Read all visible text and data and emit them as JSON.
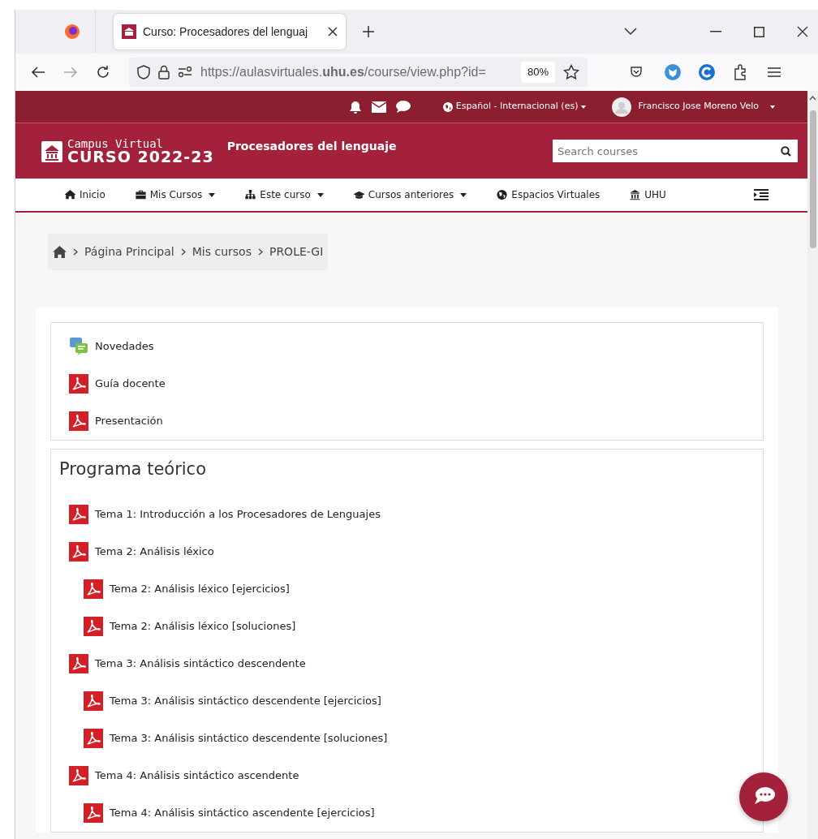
{
  "browser": {
    "tab_title": "Curso: Procesadores del lenguaj",
    "url": "https://aulasvirtuales.**uhu.es**/course/view.php?id=",
    "zoom": "80%",
    "forward_disabled": true
  },
  "topbar": {
    "language": "Español - Internacional (es)",
    "user": "Francisco Jose Moreno Velo"
  },
  "header": {
    "logo_line1": "Campus Virtual",
    "logo_line2": "CURSO 2022-23",
    "course_title": "Procesadores del lenguaje",
    "search_placeholder": "Search courses"
  },
  "nav": [
    {
      "label": "Inicio",
      "dropdown": false
    },
    {
      "label": "Mis Cursos",
      "dropdown": true
    },
    {
      "label": "Este curso",
      "dropdown": true
    },
    {
      "label": "Cursos anteriores",
      "dropdown": true
    },
    {
      "label": "Espacios Virtuales",
      "dropdown": false
    },
    {
      "label": "UHU",
      "dropdown": false
    }
  ],
  "breadcrumb": [
    "Página Principal",
    "Mis cursos",
    "PROLE-GI"
  ],
  "sections": [
    {
      "items": [
        {
          "kind": "forum",
          "label": "Novedades"
        },
        {
          "kind": "pdf",
          "label": "Guía docente"
        },
        {
          "kind": "pdf",
          "label": "Presentación"
        }
      ]
    },
    {
      "title": "Programa teórico",
      "items": [
        {
          "kind": "pdf",
          "label": "Tema 1: Introducción a los Procesadores de Lenguajes"
        },
        {
          "kind": "pdf",
          "label": "Tema 2: Análisis léxico",
          "children": [
            {
              "kind": "pdf",
              "label": "Tema 2: Análisis léxico [ejercicios]"
            },
            {
              "kind": "pdf",
              "label": "Tema 2: Análisis léxico [soluciones]"
            }
          ]
        },
        {
          "kind": "pdf",
          "label": "Tema 3: Análisis sintáctico descendente",
          "children": [
            {
              "kind": "pdf",
              "label": "Tema 3: Análisis sintáctico descendente [ejercicios]"
            },
            {
              "kind": "pdf",
              "label": "Tema 3: Análisis sintáctico descendente [soluciones]"
            }
          ]
        },
        {
          "kind": "pdf",
          "label": "Tema 4: Análisis sintáctico ascendente",
          "children": [
            {
              "kind": "pdf",
              "label": "Tema 4: Análisis sintáctico ascendente [ejercicios]"
            }
          ]
        }
      ]
    }
  ]
}
